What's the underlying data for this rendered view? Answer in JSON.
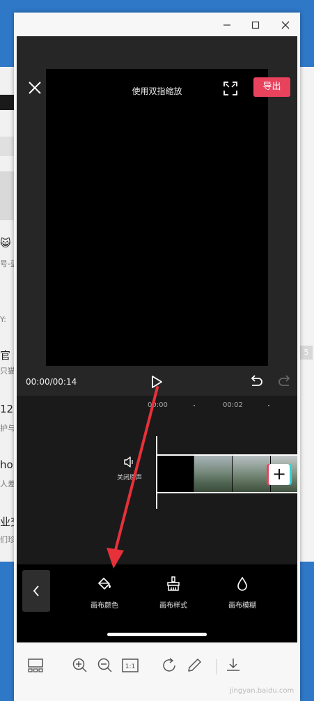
{
  "background_left": {
    "fragments": [
      "😺",
      "号-蓝",
      "Y:",
      "官",
      "只猫",
      "12",
      "护与",
      "ho",
      "人差",
      "业交",
      "们珍"
    ]
  },
  "background_right": {
    "badge": "5"
  },
  "preview": {
    "hint": "使用双指缩放",
    "export_label": "导出"
  },
  "playback": {
    "time": "00:00/00:14"
  },
  "timeline": {
    "ticks": [
      "00:00",
      "00:02"
    ],
    "mute_label": "关闭原声"
  },
  "toolbar": {
    "tools": [
      {
        "label": "画布颜色",
        "icon": "paint-bucket-icon"
      },
      {
        "label": "画布样式",
        "icon": "brush-icon"
      },
      {
        "label": "画布模糊",
        "icon": "droplet-icon"
      }
    ]
  },
  "viewer": {
    "watermark": "jingyan.baidu.com"
  },
  "colors": {
    "accent": "#e8425c",
    "annotation_arrow": "#e8303a"
  }
}
